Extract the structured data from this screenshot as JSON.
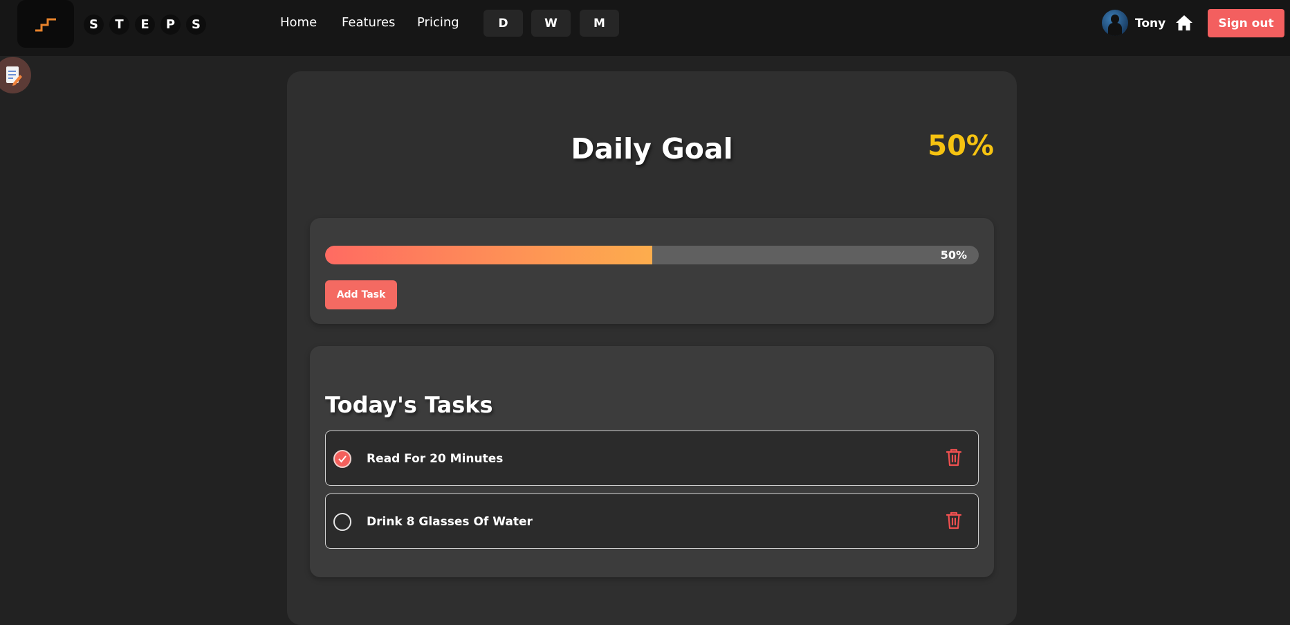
{
  "brand": {
    "letters": [
      "S",
      "T",
      "E",
      "P",
      "S"
    ]
  },
  "nav": {
    "links": [
      "Home",
      "Features",
      "Pricing"
    ],
    "view_buttons": [
      "D",
      "W",
      "M"
    ]
  },
  "user": {
    "name": "Tony"
  },
  "signout_label": "Sign out",
  "icons": {
    "logo": "stairs-icon",
    "home": "home-icon",
    "side_action": "edit-note-icon",
    "delete": "trash-icon",
    "check": "check-icon"
  },
  "colors": {
    "accent": "#f35f5f",
    "goal_percent": "#f6c311",
    "progress_start": "#ff6b62",
    "progress_end": "#fdad4d"
  },
  "goal": {
    "title": "Daily Goal",
    "percent_label": "50%",
    "progress": 0.5,
    "progress_label": "50%",
    "add_task_label": "Add Task"
  },
  "tasks": {
    "title": "Today's Tasks",
    "items": [
      {
        "label": "Read For 20 Minutes",
        "done": true
      },
      {
        "label": "Drink 8 Glasses Of Water",
        "done": false
      }
    ]
  }
}
